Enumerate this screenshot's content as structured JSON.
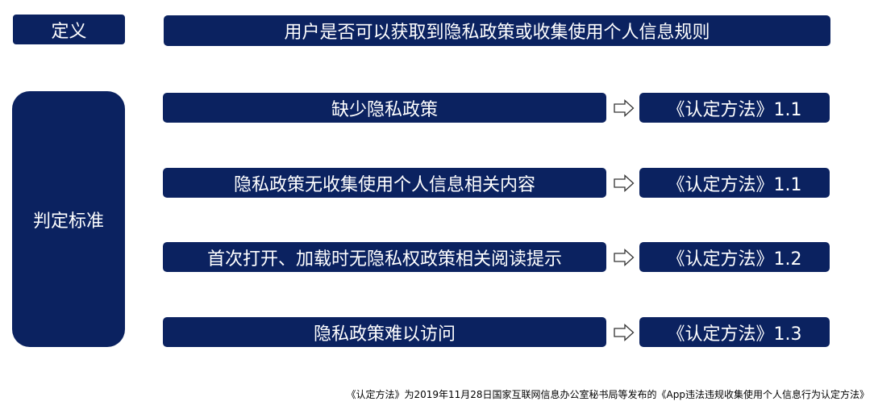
{
  "definition": {
    "label": "定义",
    "text": "用户是否可以获取到隐私政策或收集使用个人信息规则"
  },
  "criteria": {
    "label": "判定标准",
    "items": [
      {
        "text": "缺少隐私政策",
        "reference": "《认定方法》1.1"
      },
      {
        "text": "隐私政策无收集使用个人信息相关内容",
        "reference": "《认定方法》1.1"
      },
      {
        "text": "首次打开、加载时无隐私权政策相关阅读提示",
        "reference": "《认定方法》1.2"
      },
      {
        "text": "隐私政策难以访问",
        "reference": "《认定方法》1.3"
      }
    ]
  },
  "footnote": "《认定方法》为2019年11月28日国家互联网信息办公室秘书局等发布的《App违法违规收集使用个人信息行为认定方法》",
  "colors": {
    "box_background": "#0b2260",
    "box_text": "#ffffff"
  },
  "icons": {
    "arrow": "right-arrow-outline-icon"
  }
}
